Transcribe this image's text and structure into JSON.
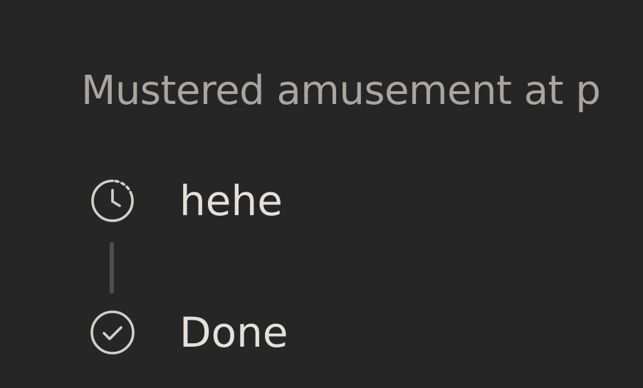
{
  "header": {
    "text": "Mustered amusement at p"
  },
  "timeline": {
    "steps": [
      {
        "icon": "clock-icon",
        "label": "hehe"
      },
      {
        "icon": "check-circle-icon",
        "label": "Done"
      }
    ]
  },
  "colors": {
    "background": "#262626",
    "header_text": "#a9a69f",
    "label_text": "#e4e1da",
    "icon_stroke": "#d3d0c9",
    "connector": "#4f4e4b"
  }
}
